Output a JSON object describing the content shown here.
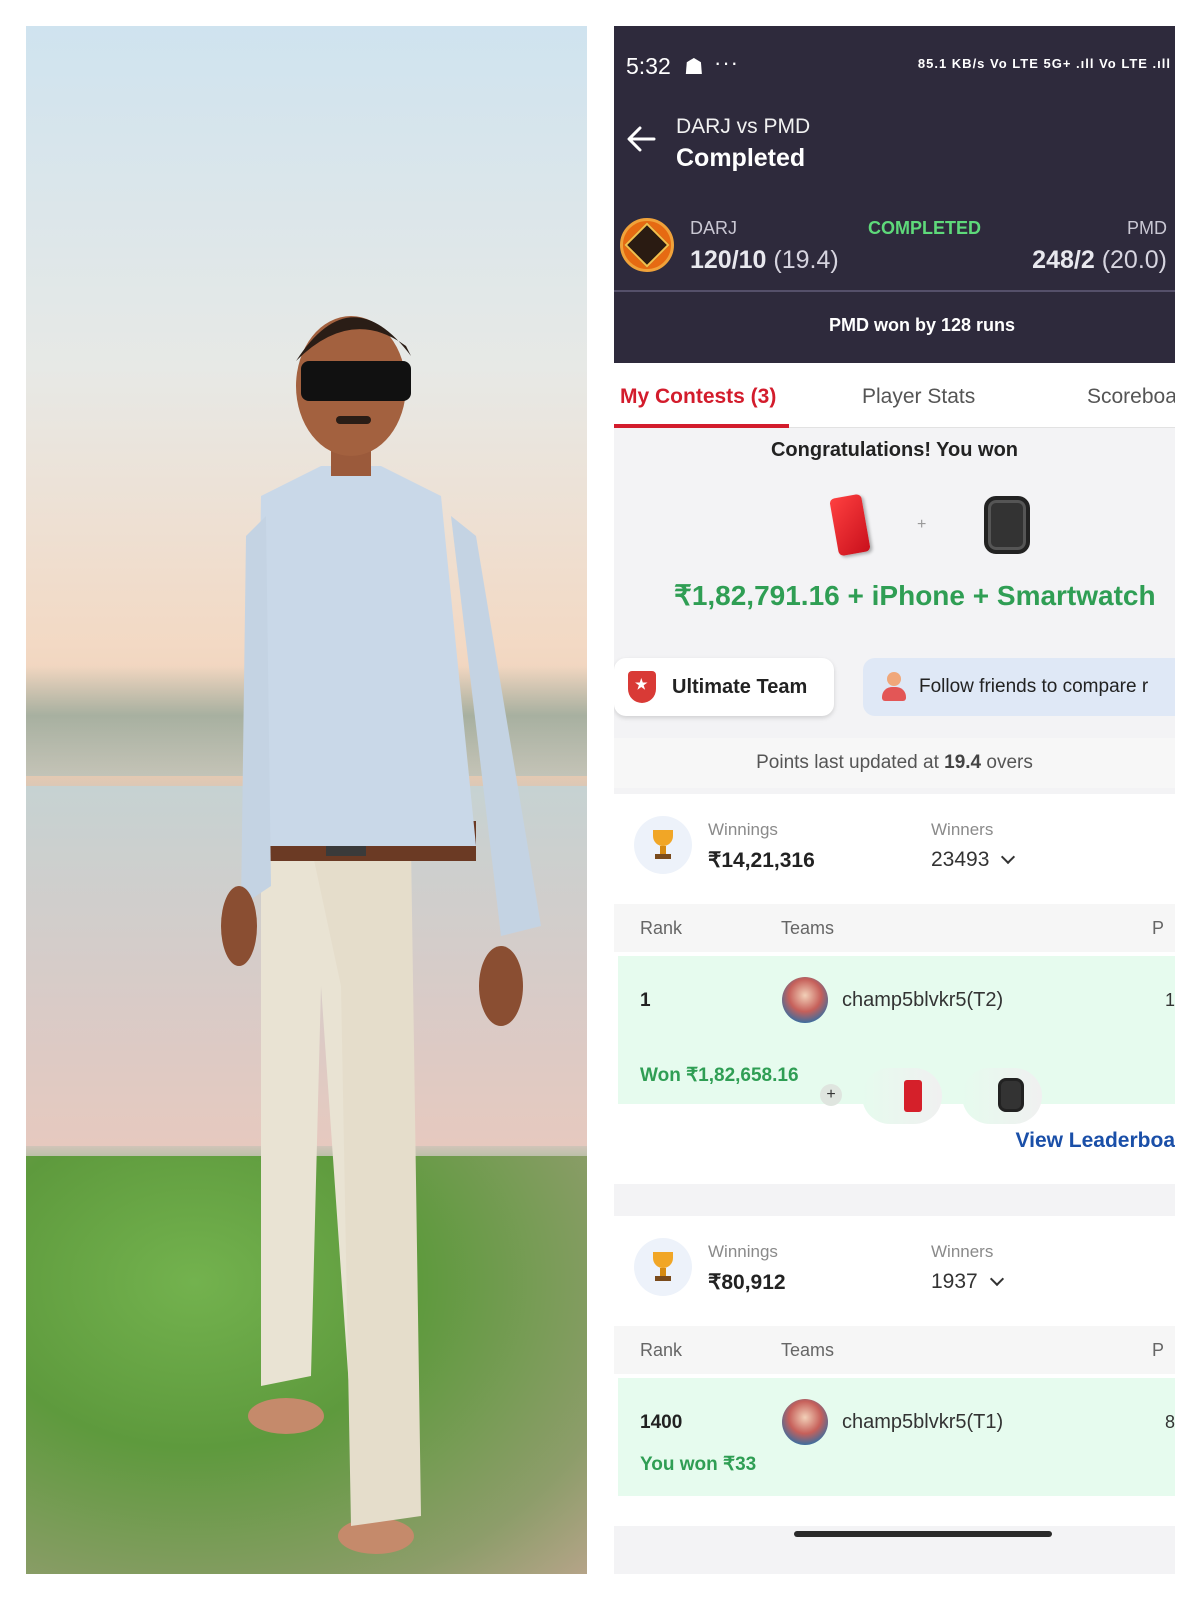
{
  "status_bar": {
    "time": "5:32",
    "network": "85.1 KB/s  Vo LTE  5G+ .ıll  Vo LTE .ıll"
  },
  "header": {
    "match_title": "DARJ vs PMD",
    "match_status": "Completed",
    "team1": {
      "name": "DARJ",
      "score": "120/10",
      "overs": "(19.4)"
    },
    "team2": {
      "name": "PMD",
      "score": "248/2",
      "overs": "(20.0)"
    },
    "state_label": "COMPLETED",
    "result": "PMD won by 128 runs"
  },
  "tabs": [
    {
      "label": "My Contests (3)",
      "active": true
    },
    {
      "label": "Player Stats",
      "active": false
    },
    {
      "label": "Scoreboard",
      "active": false
    }
  ],
  "congrats": {
    "title": "Congratulations! You won",
    "prize": "₹1,82,791.16 + iPhone + Smartwatch"
  },
  "chips": {
    "ultimate_team": "Ultimate Team",
    "follow_friends": "Follow friends to compare r"
  },
  "points_update": {
    "prefix": "Points last updated at",
    "overs": "19.4",
    "suffix": "overs"
  },
  "contests": [
    {
      "winnings_label": "Winnings",
      "winnings": "₹14,21,316",
      "winners_label": "Winners",
      "winners": "23493",
      "rank_header": "Rank",
      "teams_header": "Teams",
      "points_header": "P",
      "rank": "1",
      "team": "champ5blvkr5(T2)",
      "points": "1",
      "won": "Won ₹1,82,658.16",
      "plus": "+",
      "view_leaderboard": "View Leaderboa"
    },
    {
      "winnings_label": "Winnings",
      "winnings": "₹80,912",
      "winners_label": "Winners",
      "winners": "1937",
      "rank_header": "Rank",
      "teams_header": "Teams",
      "points_header": "P",
      "rank": "1400",
      "team": "champ5blvkr5(T1)",
      "points": "8",
      "won": "You won ₹33"
    }
  ],
  "colors": {
    "header_bg": "#2e2a3c",
    "accent_red": "#d31c2c",
    "win_green": "#2f9e54",
    "link_blue": "#1a4fa8"
  }
}
